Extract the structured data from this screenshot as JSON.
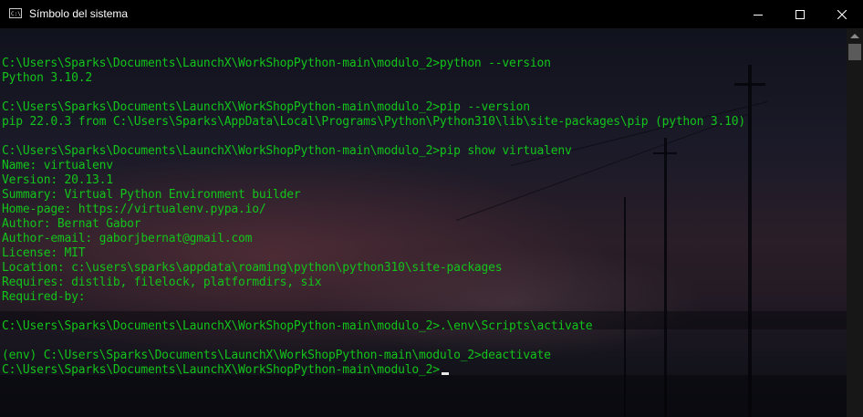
{
  "window": {
    "title": "Símbolo del sistema",
    "icon": "C:\\",
    "controls": {
      "minimize": "minimize-icon",
      "maximize": "maximize-icon",
      "close": "close-icon"
    }
  },
  "colors": {
    "text": "#13c41b",
    "titlebar": "#000000",
    "cursor": "#e8e8e8"
  },
  "console": {
    "lines": [
      "",
      "C:\\Users\\Sparks\\Documents\\LaunchX\\WorkShopPython-main\\modulo_2>python --version",
      "Python 3.10.2",
      "",
      "C:\\Users\\Sparks\\Documents\\LaunchX\\WorkShopPython-main\\modulo_2>pip --version",
      "pip 22.0.3 from C:\\Users\\Sparks\\AppData\\Local\\Programs\\Python\\Python310\\lib\\site-packages\\pip (python 3.10)",
      "",
      "C:\\Users\\Sparks\\Documents\\LaunchX\\WorkShopPython-main\\modulo_2>pip show virtualenv",
      "Name: virtualenv",
      "Version: 20.13.1",
      "Summary: Virtual Python Environment builder",
      "Home-page: https://virtualenv.pypa.io/",
      "Author: Bernat Gabor",
      "Author-email: gaborjbernat@gmail.com",
      "License: MIT",
      "Location: c:\\users\\sparks\\appdata\\roaming\\python\\python310\\site-packages",
      "Requires: distlib, filelock, platformdirs, six",
      "Required-by:",
      "",
      "C:\\Users\\Sparks\\Documents\\LaunchX\\WorkShopPython-main\\modulo_2>.\\env\\Scripts\\activate",
      "",
      "(env) C:\\Users\\Sparks\\Documents\\LaunchX\\WorkShopPython-main\\modulo_2>deactivate",
      "C:\\Users\\Sparks\\Documents\\LaunchX\\WorkShopPython-main\\modulo_2>"
    ]
  }
}
